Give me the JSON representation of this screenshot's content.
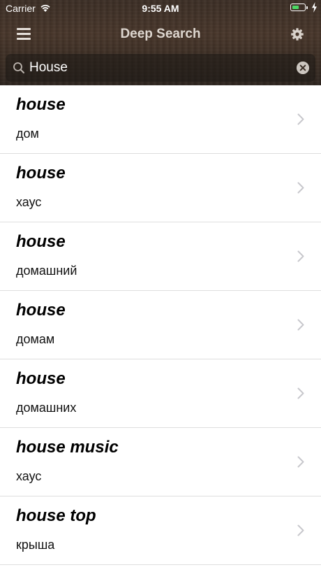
{
  "status_bar": {
    "carrier": "Carrier",
    "time": "9:55 AM",
    "battery_level": 0.6,
    "battery_color": "#4cd964"
  },
  "nav": {
    "title": "Deep Search",
    "menu_icon": "hamburger-menu-icon",
    "settings_icon": "gear-icon"
  },
  "search": {
    "value": "House",
    "placeholder": "",
    "search_icon": "magnifier-icon",
    "clear_icon": "clear-circle-icon"
  },
  "results": [
    {
      "term": "house",
      "translation": "дом"
    },
    {
      "term": "house",
      "translation": "хаус"
    },
    {
      "term": "house",
      "translation": "домашний"
    },
    {
      "term": "house",
      "translation": "домам"
    },
    {
      "term": "house",
      "translation": "домашних"
    },
    {
      "term": "house music",
      "translation": "хаус"
    },
    {
      "term": "house top",
      "translation": "крыша"
    }
  ],
  "colors": {
    "header_brown": "#3e3027",
    "title_text": "#ddd6cf",
    "separator": "#dedede",
    "chevron": "#c7c7cc"
  }
}
